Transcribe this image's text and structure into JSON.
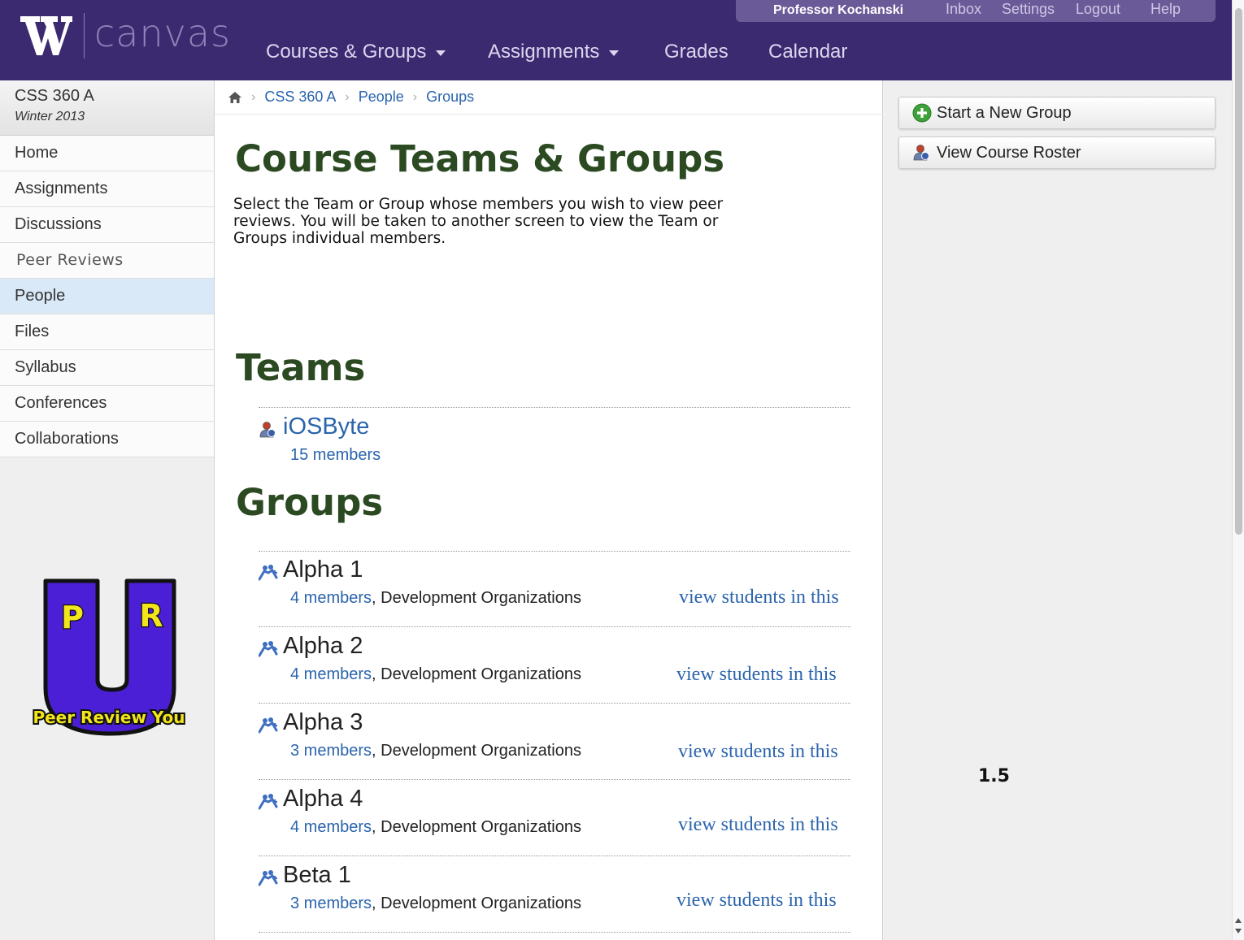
{
  "header": {
    "logo_text": "canvas",
    "user_name": "Professor Kochanski",
    "user_links": [
      "Inbox",
      "Settings",
      "Logout",
      "Help"
    ],
    "nav": {
      "courses": "Courses & Groups",
      "assignments": "Assignments",
      "grades": "Grades",
      "calendar": "Calendar"
    }
  },
  "course": {
    "name": "CSS 360 A",
    "term": "Winter 2013"
  },
  "sidebar": {
    "items": [
      "Home",
      "Assignments",
      "Discussions",
      "Peer Reviews",
      "People",
      "Files",
      "Syllabus",
      "Conferences",
      "Collaborations"
    ],
    "active": "People",
    "logo": {
      "letters": [
        "P",
        "R"
      ],
      "caption": "Peer Review You"
    }
  },
  "breadcrumb": [
    "CSS 360 A",
    "People",
    "Groups"
  ],
  "page": {
    "title": "Course Teams & Groups",
    "description": "Select the Team or Group whose members you wish to view peer reviews. You will be taken to another screen to view the Team or Groups individual members."
  },
  "teams": {
    "heading": "Teams",
    "items": [
      {
        "name": "iOSByte",
        "members": "15 members"
      }
    ]
  },
  "groups": {
    "heading": "Groups",
    "view_label": "view students in this",
    "items": [
      {
        "name": "Alpha 1",
        "members": "4 members",
        "category": ", Development Organizations"
      },
      {
        "name": "Alpha 2",
        "members": "4 members",
        "category": ", Development Organizations"
      },
      {
        "name": "Alpha 3",
        "members": "3 members",
        "category": ", Development Organizations"
      },
      {
        "name": "Alpha 4",
        "members": "4 members",
        "category": ", Development Organizations"
      },
      {
        "name": "Beta 1",
        "members": "3 members",
        "category": ", Development Organizations"
      }
    ]
  },
  "right_sidebar": {
    "start_group": "Start a New Group",
    "view_roster": "View Course Roster"
  },
  "version": "1.5",
  "colors": {
    "header_bg": "#3c2a70",
    "title_green": "#2b4a22",
    "link_blue": "#2a64ad",
    "active_nav": "#d9e9f7"
  }
}
